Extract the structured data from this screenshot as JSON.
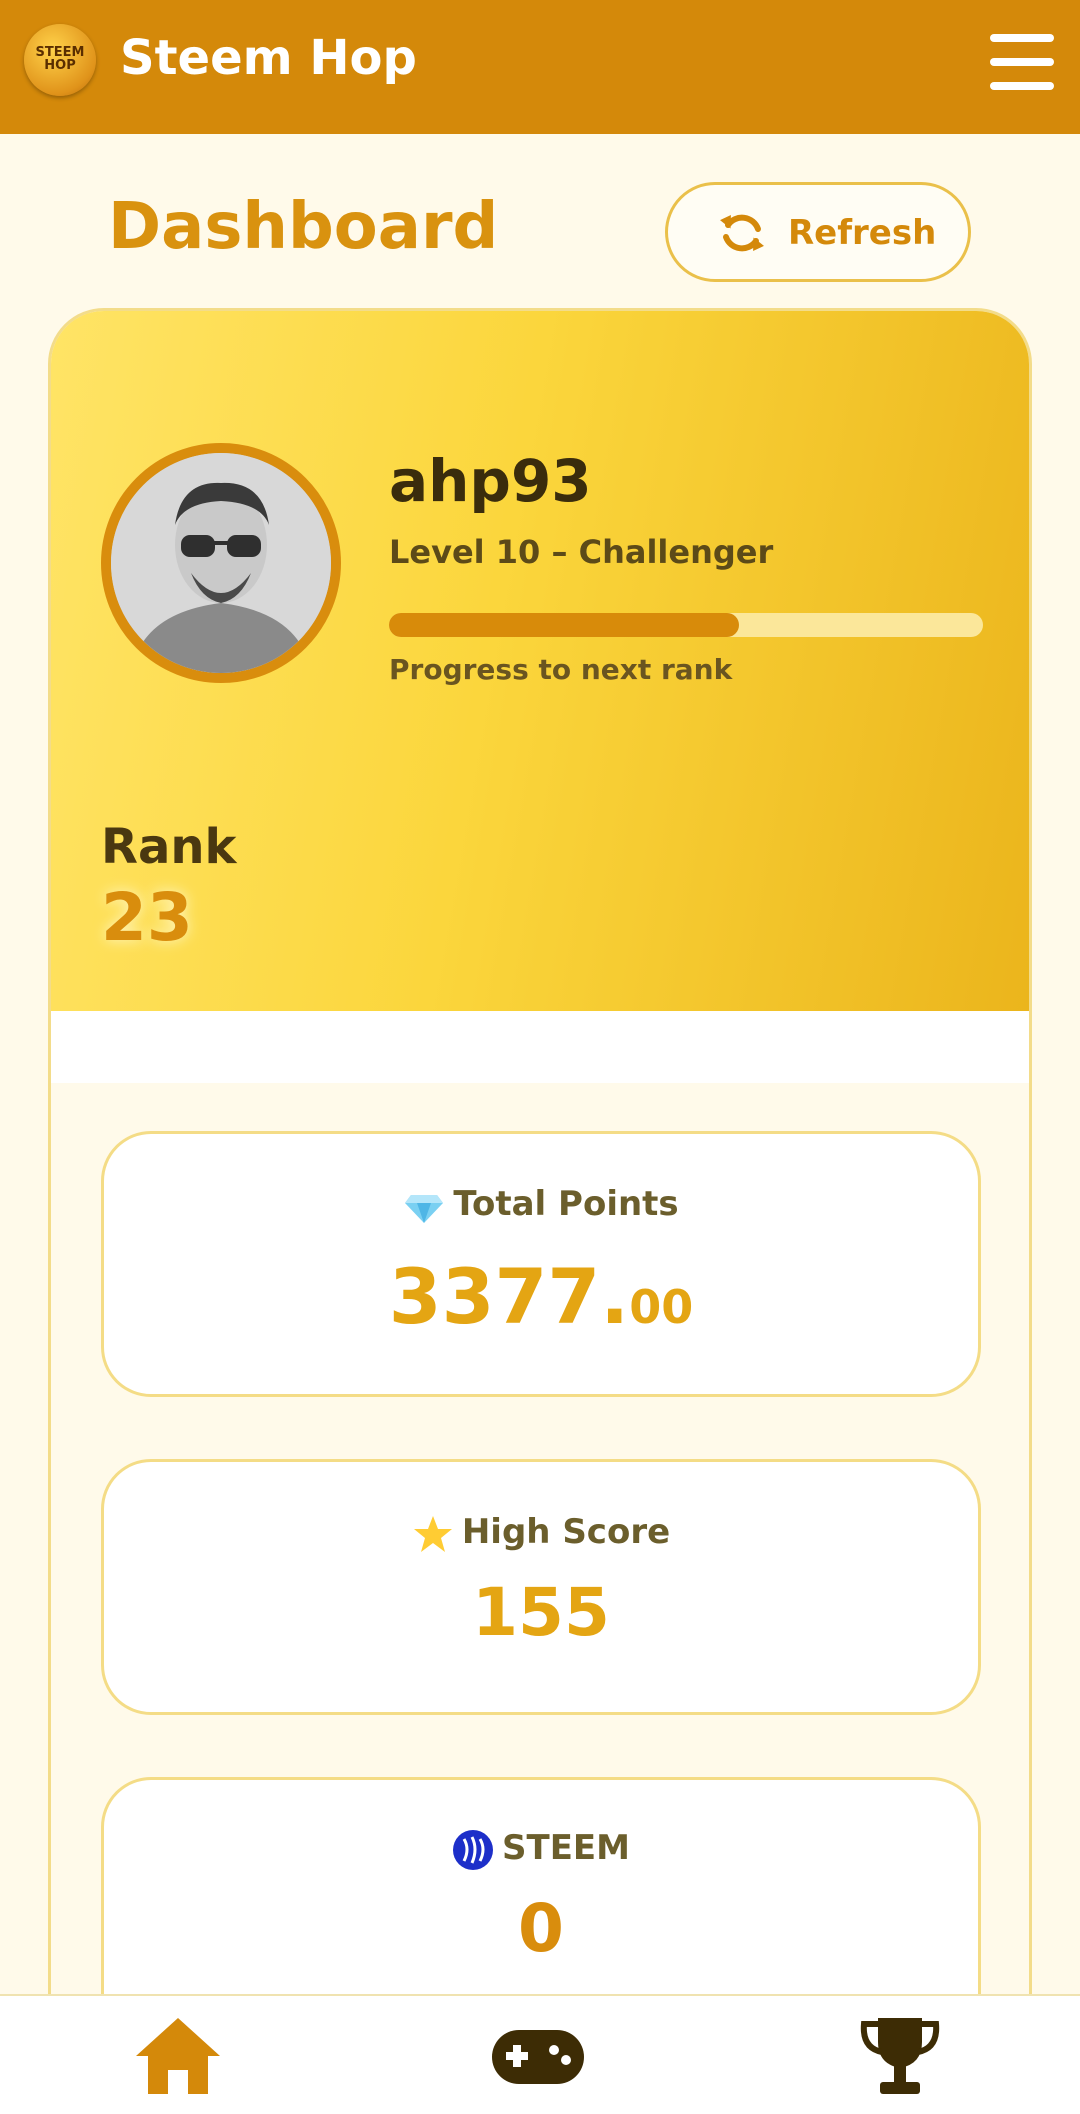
{
  "header": {
    "app_title": "Steem Hop",
    "logo_text": "STEEM HOP"
  },
  "page": {
    "title": "Dashboard",
    "refresh_label": "Refresh"
  },
  "profile": {
    "username": "ahp93",
    "level_text": "Level 10 – Challenger",
    "progress": 0.59,
    "progress_label": "Progress to next rank",
    "rank_label": "Rank",
    "rank_value": "23"
  },
  "stats": {
    "total_points": {
      "label": "Total Points",
      "value_int": "3377.",
      "value_dec": "00",
      "icon": "gem-icon"
    },
    "high_score": {
      "label": "High Score",
      "value": "155",
      "icon": "star-icon"
    },
    "steem": {
      "label": "STEEM",
      "value": "0",
      "icon": "steem-logo-icon"
    }
  },
  "nav": {
    "items": [
      "home-icon",
      "gamepad-icon",
      "trophy-icon"
    ]
  },
  "colors": {
    "header": "#d4890a",
    "accent": "#d98d0d",
    "gold": "#e4a513",
    "background": "#fffaea"
  }
}
